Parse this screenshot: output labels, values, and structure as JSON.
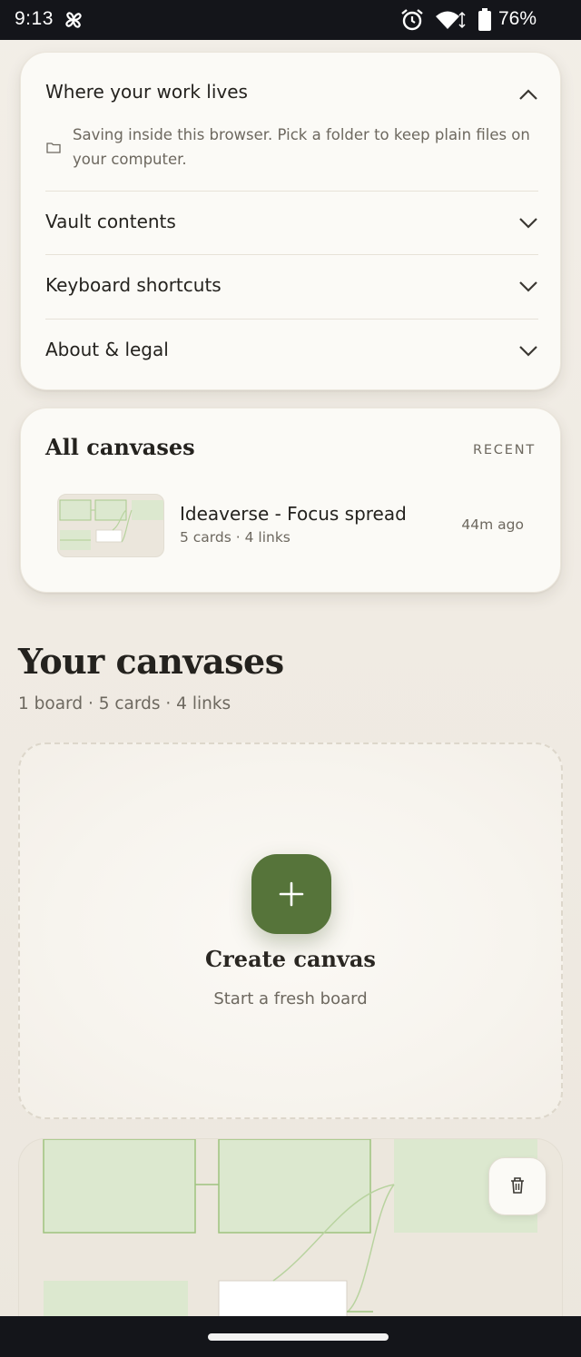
{
  "status_bar": {
    "time": "9:13",
    "battery": "76%",
    "icons": [
      "pinwheel-icon",
      "alarm-icon",
      "wifi-icon",
      "battery-icon"
    ]
  },
  "settings": {
    "where_title": "Where your work lives",
    "where_desc": "Saving inside this browser. Pick a folder to keep plain files on your computer.",
    "sections": [
      {
        "label": "Vault contents"
      },
      {
        "label": "Keyboard shortcuts"
      },
      {
        "label": "About & legal"
      }
    ]
  },
  "all_canvases": {
    "title": "All canvases",
    "sort_label": "RECENT",
    "items": [
      {
        "name": "Ideaverse - Focus spread",
        "meta": "5 cards · 4 links",
        "time": "44m ago"
      }
    ]
  },
  "your_canvases": {
    "title": "Your canvases",
    "summary": "1 board · 5 cards · 4 links"
  },
  "create": {
    "title": "Create canvas",
    "subtitle": "Start a fresh board"
  },
  "colors": {
    "accent": "#56743a",
    "card_bg": "#fbfaf6",
    "page_bg": "#f2eee7",
    "node_fill": "#dce8cf",
    "node_border": "#a9c98d"
  }
}
